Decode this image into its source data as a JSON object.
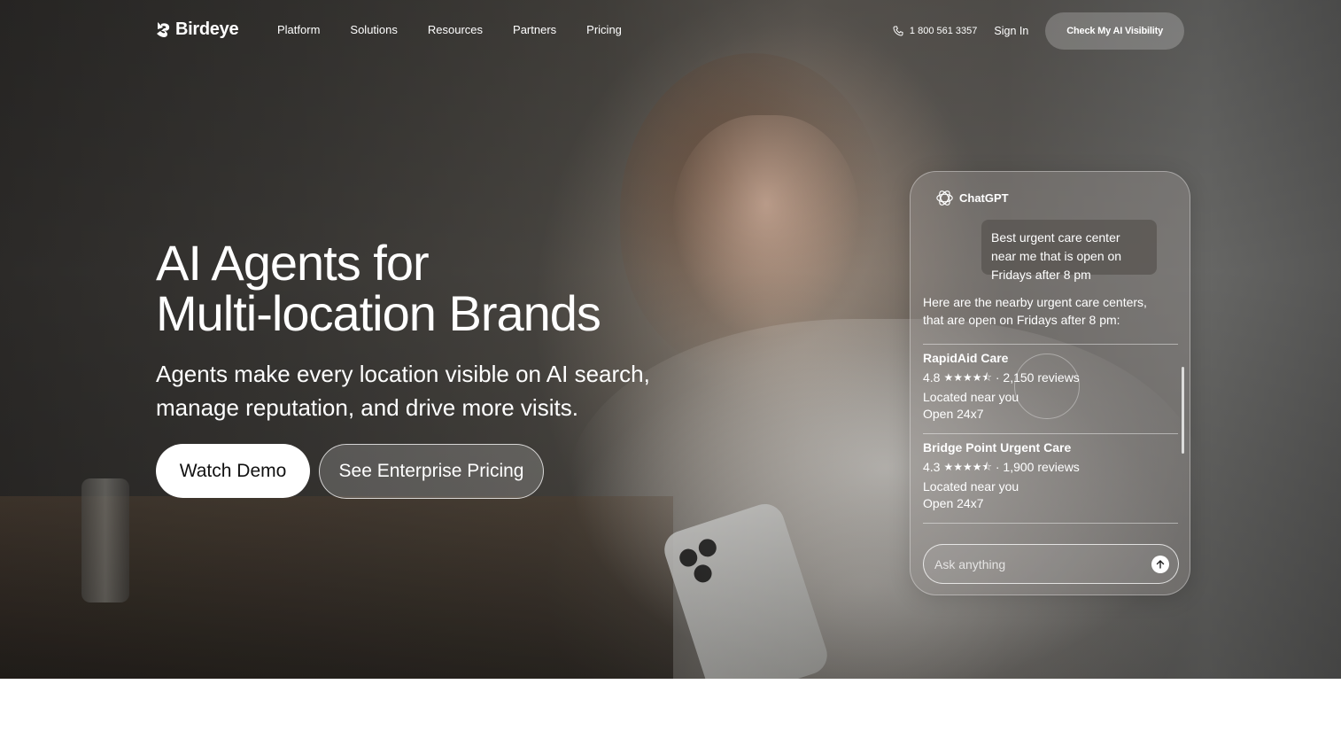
{
  "brand": {
    "name": "Birdeye"
  },
  "nav": {
    "links": [
      "Platform",
      "Solutions",
      "Resources",
      "Partners",
      "Pricing"
    ],
    "phone": "1 800 561 3357",
    "sign_in": "Sign In",
    "cta": "Check My AI Visibility"
  },
  "hero": {
    "headline_line1": "AI Agents for",
    "headline_line2": "Multi-location Brands",
    "subhead": "Agents make every location visible on AI search, manage reputation, and drive more visits.",
    "primary_button": "Watch Demo",
    "secondary_button": "See Enterprise Pricing"
  },
  "chat": {
    "app_name": "ChatGPT",
    "user_message": "Best urgent care center near me that is open on Fridays after 8 pm",
    "assistant_intro": "Here are the nearby urgent care centers, that are open on Fridays after 8 pm:",
    "results": [
      {
        "name": "RapidAid Care",
        "rating": "4.8",
        "stars": "★★★★⯪",
        "reviews": "· 2,150 reviews",
        "location": "Located near you",
        "hours": "Open 24x7"
      },
      {
        "name": "Bridge Point Urgent Care",
        "rating": "4.3",
        "stars": "★★★★⯪",
        "reviews": "· 1,900 reviews",
        "location": "Located near you",
        "hours": "Open 24x7"
      }
    ],
    "input_placeholder": "Ask anything"
  }
}
